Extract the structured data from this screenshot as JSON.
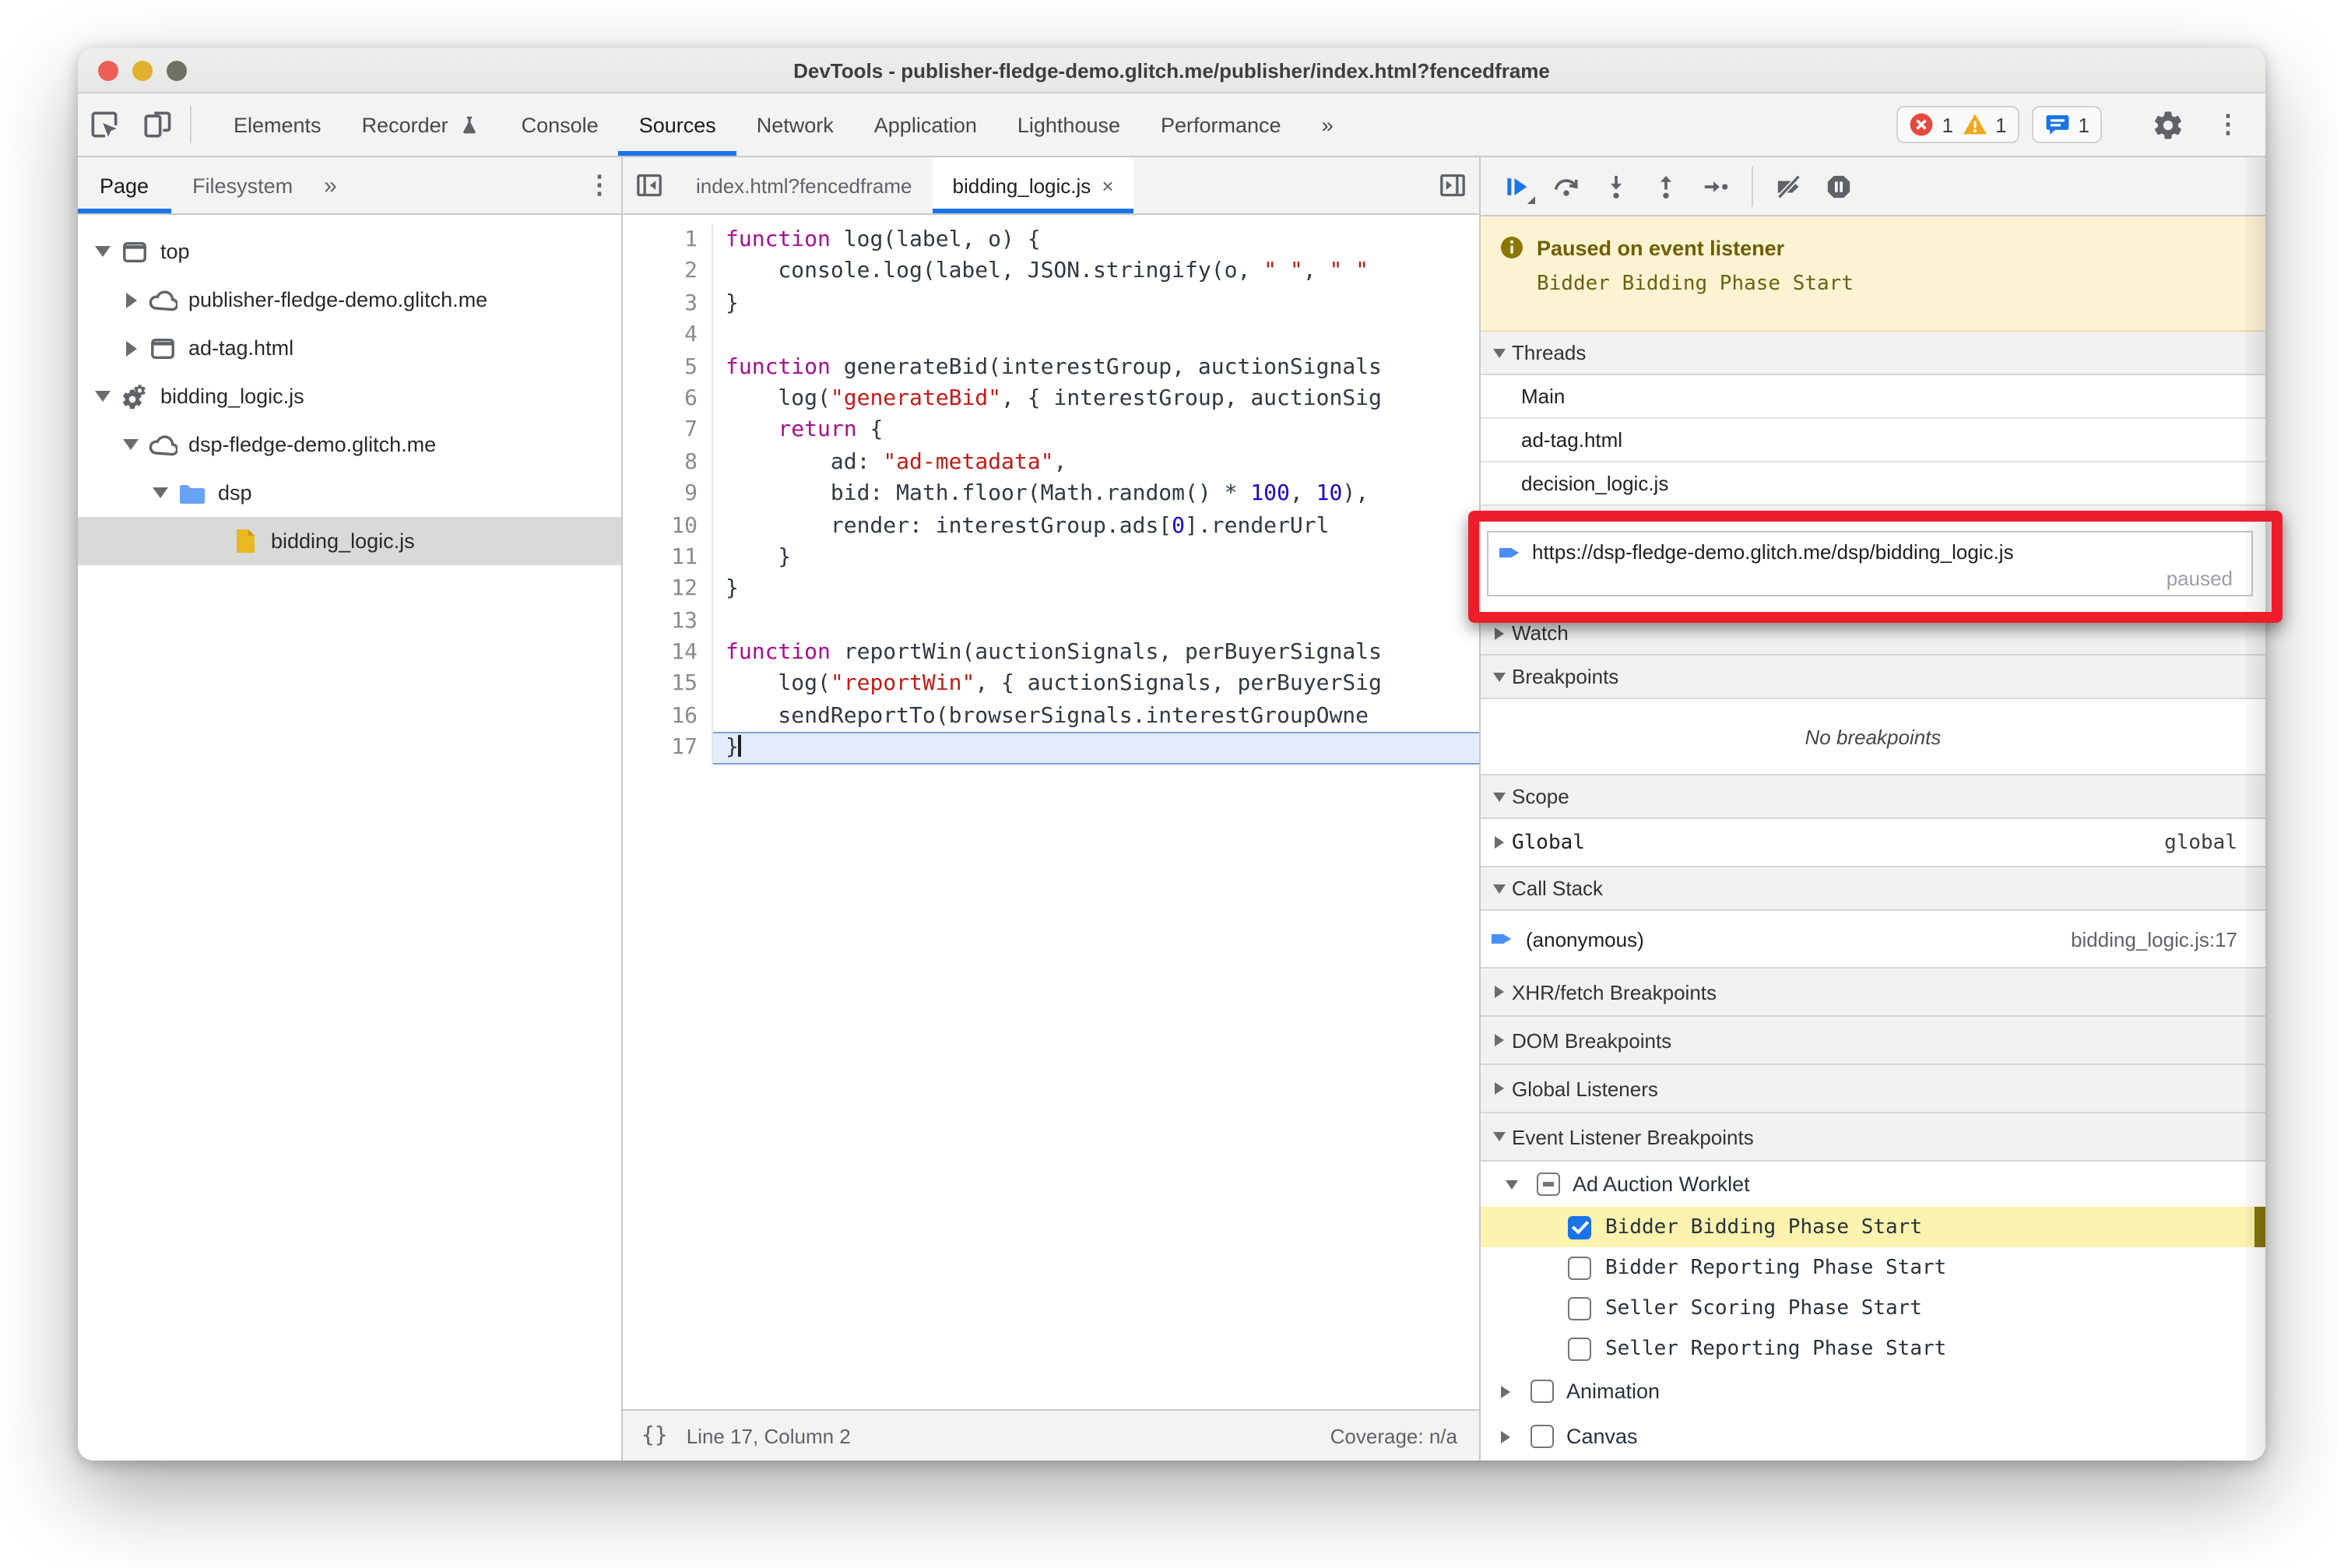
{
  "theme": {
    "accent": "#1a73e8",
    "annotation_red": "#ee1d2b",
    "paused_bg": "#fcf3d2",
    "paused_text": "#6f5d00",
    "highlight_yellow": "#fbf3ae",
    "token_keyword": "#aa0d91",
    "token_string": "#c41a16",
    "token_number": "#1c00cf",
    "token_plain": "#303942",
    "traffic_red": "#ed5f56",
    "traffic_yellow": "#e0b12c",
    "traffic_gray": "#6f7066",
    "error_red": "#e5493d",
    "warning_yellow": "#f0a71c",
    "folder_blue": "#69a1f4",
    "file_yellow": "#e9b922",
    "exec_arrow_blue": "#4a8df8"
  },
  "window": {
    "title": "DevTools - publisher-fledge-demo.glitch.me/publisher/index.html?fencedframe"
  },
  "toolbar": {
    "tabs": [
      {
        "label": "Elements",
        "active": false
      },
      {
        "label": "Recorder",
        "active": false,
        "icon": "flask"
      },
      {
        "label": "Console",
        "active": false
      },
      {
        "label": "Sources",
        "active": true
      },
      {
        "label": "Network",
        "active": false
      },
      {
        "label": "Application",
        "active": false
      },
      {
        "label": "Lighthouse",
        "active": false
      },
      {
        "label": "Performance",
        "active": false
      },
      {
        "label": "»",
        "active": false,
        "more": true
      }
    ],
    "badges": {
      "errors": "1",
      "warnings": "1",
      "issues": "1"
    }
  },
  "sidebar": {
    "tabs": [
      {
        "label": "Page",
        "active": true
      },
      {
        "label": "Filesystem",
        "active": false
      }
    ],
    "more_label": "»",
    "tree": [
      {
        "label": "top",
        "icon": "frame",
        "arrow": "down",
        "level": 0
      },
      {
        "label": "publisher-fledge-demo.glitch.me",
        "icon": "cloud",
        "arrow": "right",
        "level": 1
      },
      {
        "label": "ad-tag.html",
        "icon": "frame",
        "arrow": "right",
        "level": 1
      },
      {
        "label": "bidding_logic.js",
        "icon": "worker",
        "arrow": "down",
        "level": 0
      },
      {
        "label": "dsp-fledge-demo.glitch.me",
        "icon": "cloud",
        "arrow": "down",
        "level": 1
      },
      {
        "label": "dsp",
        "icon": "folder",
        "arrow": "down",
        "level": 2
      },
      {
        "label": "bidding_logic.js",
        "icon": "file",
        "arrow": "none",
        "level": 3,
        "selected": true
      }
    ]
  },
  "editor": {
    "tabs": [
      {
        "label": "index.html?fencedframe",
        "active": false,
        "close": false
      },
      {
        "label": "bidding_logic.js",
        "active": true,
        "close": true
      }
    ],
    "close_glyph": "×",
    "lines": [
      {
        "n": "1",
        "seg": [
          [
            "k",
            "function"
          ],
          [
            "p",
            " log(label, o) {"
          ]
        ]
      },
      {
        "n": "2",
        "seg": [
          [
            "p",
            "    console.log(label, JSON.stringify(o, "
          ],
          [
            "s",
            "\" \""
          ],
          [
            "p",
            ", "
          ],
          [
            "s",
            "\" \""
          ]
        ]
      },
      {
        "n": "3",
        "seg": [
          [
            "p",
            "}"
          ]
        ]
      },
      {
        "n": "4",
        "seg": []
      },
      {
        "n": "5",
        "seg": [
          [
            "k",
            "function"
          ],
          [
            "p",
            " generateBid(interestGroup, auctionSignals"
          ]
        ]
      },
      {
        "n": "6",
        "seg": [
          [
            "p",
            "    log("
          ],
          [
            "s",
            "\"generateBid\""
          ],
          [
            "p",
            ", { interestGroup, auctionSig"
          ]
        ]
      },
      {
        "n": "7",
        "seg": [
          [
            "k",
            "    return"
          ],
          [
            "p",
            " {"
          ]
        ]
      },
      {
        "n": "8",
        "seg": [
          [
            "p",
            "        ad: "
          ],
          [
            "s",
            "\"ad-metadata\""
          ],
          [
            "p",
            ","
          ]
        ]
      },
      {
        "n": "9",
        "seg": [
          [
            "p",
            "        bid: Math.floor(Math.random() * "
          ],
          [
            "d",
            "100"
          ],
          [
            "p",
            ", "
          ],
          [
            "d",
            "10"
          ],
          [
            "p",
            "),"
          ]
        ]
      },
      {
        "n": "10",
        "seg": [
          [
            "p",
            "        render: interestGroup.ads["
          ],
          [
            "d",
            "0"
          ],
          [
            "p",
            "].renderUrl"
          ]
        ]
      },
      {
        "n": "11",
        "seg": [
          [
            "p",
            "    }"
          ]
        ]
      },
      {
        "n": "12",
        "seg": [
          [
            "p",
            "}"
          ]
        ]
      },
      {
        "n": "13",
        "seg": []
      },
      {
        "n": "14",
        "seg": [
          [
            "k",
            "function"
          ],
          [
            "p",
            " reportWin(auctionSignals, perBuyerSignals"
          ]
        ]
      },
      {
        "n": "15",
        "seg": [
          [
            "p",
            "    log("
          ],
          [
            "s",
            "\"reportWin\""
          ],
          [
            "p",
            ", { auctionSignals, perBuyerSig"
          ]
        ]
      },
      {
        "n": "16",
        "seg": [
          [
            "p",
            "    sendReportTo(browserSignals.interestGroupOwne"
          ]
        ]
      },
      {
        "n": "17",
        "seg": [
          [
            "p",
            "}"
          ]
        ],
        "hl": true
      }
    ],
    "status": {
      "braces": "{}",
      "position": "Line 17, Column 2",
      "coverage": "Coverage: n/a"
    }
  },
  "debugger": {
    "paused_title": "Paused on event listener",
    "paused_detail": "Bidder Bidding Phase Start",
    "sections": [
      {
        "type": "header",
        "label": "Threads",
        "expanded": true
      },
      {
        "type": "thread",
        "label": "Main"
      },
      {
        "type": "thread",
        "label": "ad-tag.html"
      },
      {
        "type": "thread",
        "label": "decision_logic.js"
      },
      {
        "type": "thread-boxed",
        "label": "https://dsp-fledge-demo.glitch.me/dsp/bidding_logic.js",
        "note": "paused"
      },
      {
        "type": "header",
        "label": "Watch",
        "expanded": false
      },
      {
        "type": "header",
        "label": "Breakpoints",
        "expanded": true
      },
      {
        "type": "empty",
        "label": "No breakpoints"
      },
      {
        "type": "header",
        "label": "Scope",
        "expanded": true
      },
      {
        "type": "scope",
        "label": "Global",
        "right": "global"
      },
      {
        "type": "header",
        "label": "Call Stack",
        "expanded": true
      },
      {
        "type": "stack",
        "label": "(anonymous)",
        "right": "bidding_logic.js:17"
      },
      {
        "type": "header",
        "label": "XHR/fetch Breakpoints",
        "expanded": false,
        "tall": true
      },
      {
        "type": "header",
        "label": "DOM Breakpoints",
        "expanded": false,
        "tall": true
      },
      {
        "type": "header",
        "label": "Global Listeners",
        "expanded": false,
        "tall": true
      },
      {
        "type": "header",
        "label": "Event Listener Breakpoints",
        "expanded": true,
        "tall": true
      },
      {
        "type": "group",
        "label": "Ad Auction Worklet",
        "checkbox": "indeterminate",
        "expanded": true,
        "indent": 12
      },
      {
        "type": "check",
        "label": "Bidder Bidding Phase Start",
        "checked": true,
        "highlighted": true
      },
      {
        "type": "check",
        "label": "Bidder Reporting Phase Start",
        "checked": false
      },
      {
        "type": "check",
        "label": "Seller Scoring Phase Start",
        "checked": false
      },
      {
        "type": "check",
        "label": "Seller Reporting Phase Start",
        "checked": false
      },
      {
        "type": "group",
        "label": "Animation",
        "checkbox": "unchecked",
        "expanded": false,
        "indent": 8
      },
      {
        "type": "group",
        "label": "Canvas",
        "checkbox": "unchecked",
        "expanded": false,
        "indent": 8
      }
    ]
  }
}
